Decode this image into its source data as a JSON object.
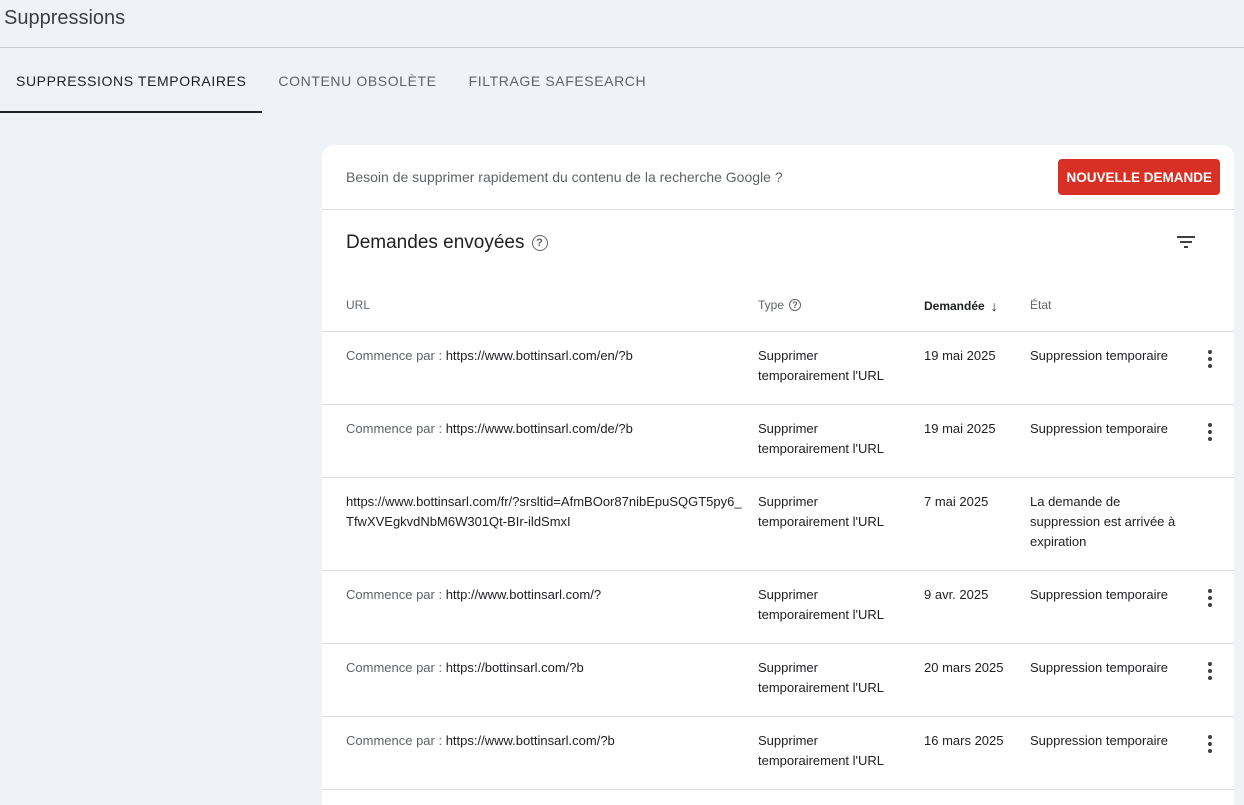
{
  "page": {
    "title": "Suppressions"
  },
  "tabs": [
    {
      "label": "SUPPRESSIONS TEMPORAIRES",
      "active": true
    },
    {
      "label": "CONTENU OBSOLÈTE",
      "active": false
    },
    {
      "label": "FILTRAGE SAFESEARCH",
      "active": false
    }
  ],
  "card": {
    "question": "Besoin de supprimer rapidement du contenu de la recherche Google ?",
    "new_request_label": "NOUVELLE DEMANDE",
    "accent_color": "#d93025"
  },
  "section": {
    "title": "Demandes envoyées"
  },
  "table": {
    "headers": {
      "url": "URL",
      "type": "Type",
      "date": "Demandée",
      "state": "État"
    },
    "rows": [
      {
        "prefix": "Commence par : ",
        "url": "https://www.bottinsarl.com/en/?b",
        "type": "Supprimer temporairement l'URL",
        "date": "19 mai 2025",
        "state": "Suppression temporaire",
        "has_menu": true
      },
      {
        "prefix": "Commence par : ",
        "url": "https://www.bottinsarl.com/de/?b",
        "type": "Supprimer temporairement l'URL",
        "date": "19 mai 2025",
        "state": "Suppression temporaire",
        "has_menu": true
      },
      {
        "prefix": "",
        "url": "https://www.bottinsarl.com/fr/?srsltid=AfmBOor87nibEpuSQGT5py6_TfwXVEgkvdNbM6W301Qt-BIr-ildSmxI",
        "type": "Supprimer temporairement l'URL",
        "date": "7 mai 2025",
        "state": "La demande de suppression est arrivée à expiration",
        "has_menu": false
      },
      {
        "prefix": "Commence par : ",
        "url": "http://www.bottinsarl.com/?",
        "type": "Supprimer temporairement l'URL",
        "date": "9 avr. 2025",
        "state": "Suppression temporaire",
        "has_menu": true
      },
      {
        "prefix": "Commence par : ",
        "url": "https://bottinsarl.com/?b",
        "type": "Supprimer temporairement l'URL",
        "date": "20 mars 2025",
        "state": "Suppression temporaire",
        "has_menu": true
      },
      {
        "prefix": "Commence par : ",
        "url": "https://www.bottinsarl.com/?b",
        "type": "Supprimer temporairement l'URL",
        "date": "16 mars 2025",
        "state": "Suppression temporaire",
        "has_menu": true
      }
    ]
  }
}
